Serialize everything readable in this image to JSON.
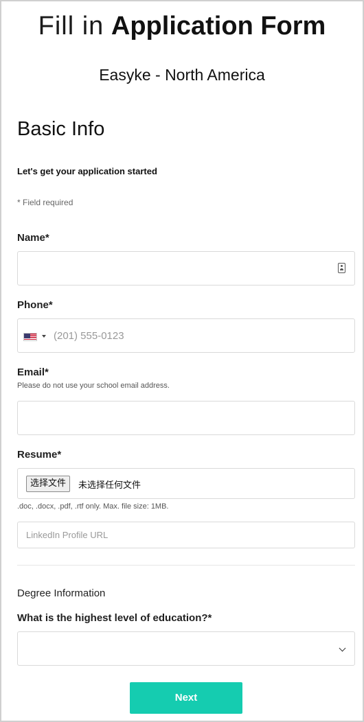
{
  "header": {
    "title_light": "Fill in",
    "title_bold": "Application Form",
    "company": "Easyke - North America"
  },
  "section": {
    "title": "Basic Info",
    "intro": "Let's get your application started",
    "required_note": "* Field required"
  },
  "fields": {
    "name": {
      "label": "Name*",
      "value": "",
      "icon": "contact-card-icon"
    },
    "phone": {
      "label": "Phone*",
      "country_flag": "us-flag-icon",
      "placeholder": "(201) 555-0123"
    },
    "email": {
      "label": "Email*",
      "hint": "Please do not use your school email address.",
      "value": ""
    },
    "resume": {
      "label": "Resume*",
      "button": "选择文件",
      "status": "未选择任何文件",
      "hint": ".doc, .docx, .pdf, .rtf only. Max. file size: 1MB."
    },
    "linkedin": {
      "placeholder": "LinkedIn Profile URL"
    }
  },
  "degree": {
    "heading": "Degree Information",
    "question": "What is the highest level of education?*",
    "selected": ""
  },
  "actions": {
    "next": "Next"
  },
  "colors": {
    "accent": "#15ccb0"
  }
}
